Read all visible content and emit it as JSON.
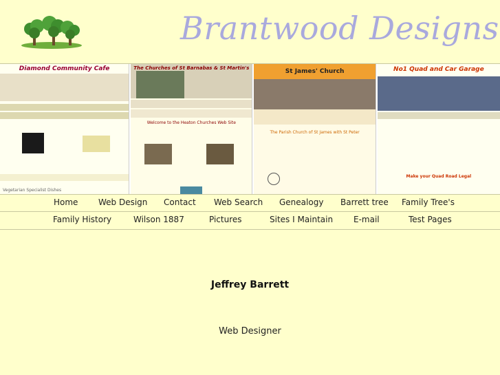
{
  "header": {
    "site_title": "Brantwood Designs",
    "logo_icon": "trees-logo-icon"
  },
  "thumbnails": [
    {
      "title": "Diamond Community Cafe",
      "accent": "#990033",
      "footer": "Vegetarian Specialist Dishes"
    },
    {
      "title": "The Churches of St Barnabas & St Martin's",
      "accent": "#8b0000",
      "footer": "Welcome to the Heaton Churches Web Site"
    },
    {
      "title": "St James' Church",
      "accent": "#f0a030",
      "footer": "The Parish Church of St James with St Peter"
    },
    {
      "title": "No1 Quad and Car Garage",
      "accent": "#cc3300",
      "footer": "Make your Quad Road Legal"
    }
  ],
  "nav_row1": [
    {
      "label": "Home"
    },
    {
      "label": "Web Design"
    },
    {
      "label": "Contact"
    },
    {
      "label": "Web Search"
    },
    {
      "label": "Genealogy"
    },
    {
      "label": "Barrett tree"
    },
    {
      "label": "Family Tree's"
    }
  ],
  "nav_row2": [
    {
      "label": "Family History"
    },
    {
      "label": "Wilson 1887"
    },
    {
      "label": "Pictures"
    },
    {
      "label": "Sites I Maintain"
    },
    {
      "label": "E-mail"
    },
    {
      "label": "Test Pages"
    }
  ],
  "content": {
    "name": "Jeffrey Barrett",
    "role": "Web Designer"
  },
  "colors": {
    "background": "#ffffcc",
    "title_text": "#a9a9dd"
  }
}
